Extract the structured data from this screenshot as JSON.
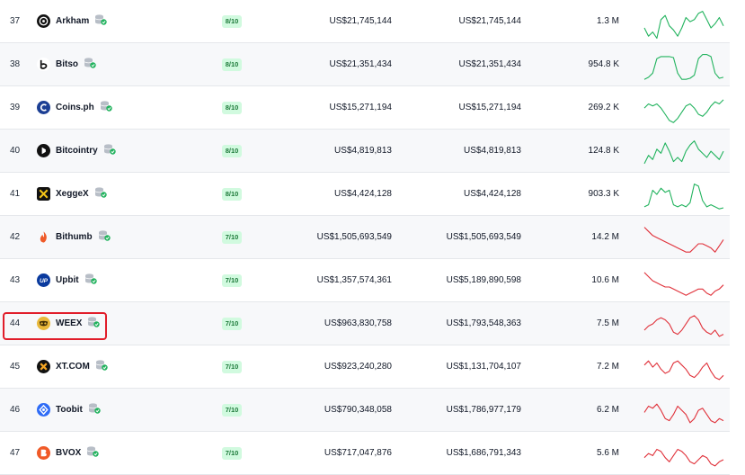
{
  "colors": {
    "positive": "#22b35e",
    "negative": "#e0313a",
    "highlight": "#e11d2a",
    "score_bg": "#d1fadf",
    "score_fg": "#1d7a3a"
  },
  "highlighted_rank": "44",
  "rows": [
    {
      "rank": "37",
      "name": "Arkham",
      "logo_icon": "arkham-logo-icon",
      "score": "8/10",
      "vol_a": "US$21,745,144",
      "vol_b": "US$21,745,144",
      "visits": "1.3 M",
      "trend": "up",
      "spark": [
        20,
        28,
        24,
        30,
        12,
        8,
        18,
        22,
        28,
        20,
        10,
        14,
        12,
        6,
        4,
        12,
        20,
        16,
        10,
        18
      ]
    },
    {
      "rank": "38",
      "name": "Bitso",
      "logo_icon": "bitso-logo-icon",
      "score": "8/10",
      "vol_a": "US$21,351,434",
      "vol_b": "US$21,351,434",
      "visits": "954.8 K",
      "trend": "up",
      "spark": [
        28,
        26,
        22,
        8,
        6,
        6,
        6,
        7,
        22,
        28,
        28,
        27,
        24,
        8,
        4,
        4,
        6,
        22,
        27,
        26
      ]
    },
    {
      "rank": "39",
      "name": "Coins.ph",
      "logo_icon": "coinsph-logo-icon",
      "score": "8/10",
      "vol_a": "US$15,271,194",
      "vol_b": "US$15,271,194",
      "visits": "269.2 K",
      "trend": "up",
      "spark": [
        14,
        10,
        12,
        10,
        14,
        20,
        26,
        28,
        24,
        18,
        12,
        10,
        14,
        20,
        22,
        18,
        12,
        8,
        10,
        6
      ]
    },
    {
      "rank": "40",
      "name": "Bitcointry",
      "logo_icon": "bitcointry-logo-icon",
      "score": "8/10",
      "vol_a": "US$4,819,813",
      "vol_b": "US$4,819,813",
      "visits": "124.8 K",
      "trend": "up",
      "spark": [
        26,
        18,
        22,
        12,
        16,
        6,
        14,
        24,
        20,
        24,
        14,
        8,
        4,
        12,
        16,
        20,
        14,
        18,
        22,
        14
      ]
    },
    {
      "rank": "41",
      "name": "XeggeX",
      "logo_icon": "xeggex-logo-icon",
      "score": "8/10",
      "vol_a": "US$4,424,128",
      "vol_b": "US$4,424,128",
      "visits": "903.3 K",
      "trend": "up",
      "spark": [
        26,
        24,
        10,
        14,
        8,
        12,
        10,
        24,
        26,
        24,
        26,
        22,
        4,
        6,
        20,
        26,
        24,
        26,
        28,
        27
      ]
    },
    {
      "rank": "42",
      "name": "Bithumb",
      "logo_icon": "bithumb-logo-icon",
      "score": "7/10",
      "vol_a": "US$1,505,693,549",
      "vol_b": "US$1,505,693,549",
      "visits": "14.2 M",
      "trend": "down",
      "spark": [
        4,
        8,
        12,
        14,
        16,
        18,
        20,
        22,
        24,
        26,
        28,
        28,
        24,
        20,
        20,
        22,
        24,
        28,
        22,
        16
      ]
    },
    {
      "rank": "43",
      "name": "Upbit",
      "logo_icon": "upbit-logo-icon",
      "score": "7/10",
      "vol_a": "US$1,357,574,361",
      "vol_b": "US$5,189,890,598",
      "visits": "10.6 M",
      "trend": "down",
      "spark": [
        6,
        10,
        14,
        16,
        18,
        20,
        20,
        22,
        24,
        26,
        28,
        26,
        24,
        22,
        22,
        26,
        28,
        24,
        22,
        18
      ]
    },
    {
      "rank": "44",
      "name": "WEEX",
      "logo_icon": "weex-logo-icon",
      "score": "7/10",
      "vol_a": "US$963,830,758",
      "vol_b": "US$1,793,548,363",
      "visits": "7.5 M",
      "trend": "down",
      "spark": [
        20,
        16,
        14,
        10,
        8,
        10,
        14,
        22,
        24,
        20,
        14,
        8,
        6,
        10,
        18,
        22,
        24,
        20,
        26,
        24
      ]
    },
    {
      "rank": "45",
      "name": "XT.COM",
      "logo_icon": "xtcom-logo-icon",
      "score": "7/10",
      "vol_a": "US$923,240,280",
      "vol_b": "US$1,131,704,107",
      "visits": "7.2 M",
      "trend": "down",
      "spark": [
        12,
        8,
        14,
        10,
        16,
        20,
        18,
        10,
        8,
        12,
        16,
        22,
        24,
        20,
        14,
        10,
        18,
        24,
        26,
        22
      ]
    },
    {
      "rank": "46",
      "name": "Toobit",
      "logo_icon": "toobit-logo-icon",
      "score": "7/10",
      "vol_a": "US$790,348,058",
      "vol_b": "US$1,786,977,179",
      "visits": "6.2 M",
      "trend": "down",
      "spark": [
        16,
        10,
        12,
        8,
        14,
        22,
        24,
        18,
        10,
        14,
        18,
        26,
        22,
        14,
        12,
        18,
        24,
        26,
        22,
        24
      ]
    },
    {
      "rank": "47",
      "name": "BVOX",
      "logo_icon": "bvox-logo-icon",
      "score": "7/10",
      "vol_a": "US$717,047,876",
      "vol_b": "US$1,686,791,343",
      "visits": "5.6 M",
      "trend": "down",
      "spark": [
        18,
        14,
        16,
        10,
        12,
        18,
        22,
        16,
        10,
        12,
        16,
        22,
        24,
        20,
        16,
        18,
        24,
        26,
        22,
        20
      ]
    }
  ]
}
